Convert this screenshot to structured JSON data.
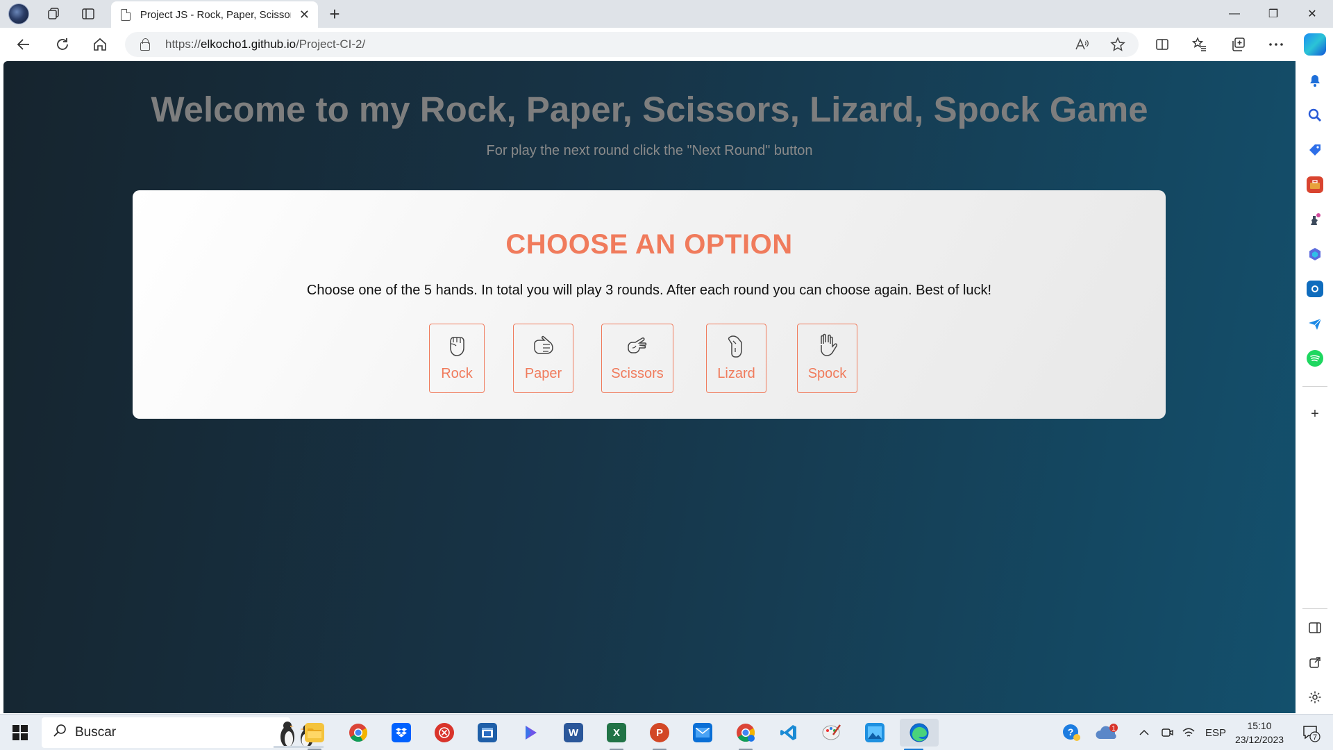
{
  "browser": {
    "tab_title": "Project JS - Rock, Paper, Scissors, Lizard, Spock",
    "tab_close": "✕",
    "new_tab": "+",
    "url_prefix": "https://",
    "url_host": "elkocho1.github.io",
    "url_path": "/Project-CI-2/",
    "window_controls": [
      "—",
      "❐",
      "✕"
    ]
  },
  "page": {
    "title": "Welcome to my Rock, Paper, Scissors, Lizard, Spock Game",
    "subtitle": "For play the next round click the \"Next Round\" button",
    "card": {
      "heading": "CHOOSE AN OPTION",
      "instructions": "Choose one of the 5 hands. In total you will play 3 rounds. After each round you can choose again. Best of luck!",
      "options": [
        {
          "label": "Rock",
          "icon": "hand-rock-icon"
        },
        {
          "label": "Paper",
          "icon": "hand-paper-icon"
        },
        {
          "label": "Scissors",
          "icon": "hand-scissors-icon"
        },
        {
          "label": "Lizard",
          "icon": "hand-lizard-icon"
        },
        {
          "label": "Spock",
          "icon": "hand-spock-icon"
        }
      ]
    },
    "colors": {
      "accent": "#f07b5c",
      "title_gray": "#7e7e7e",
      "bg_start": "#16242e",
      "bg_end": "#13506d"
    }
  },
  "taskbar": {
    "search_placeholder": "Buscar",
    "language": "ESP",
    "time": "15:10",
    "date": "23/12/2023",
    "notification_count": "7",
    "cloud_badge": "1"
  }
}
